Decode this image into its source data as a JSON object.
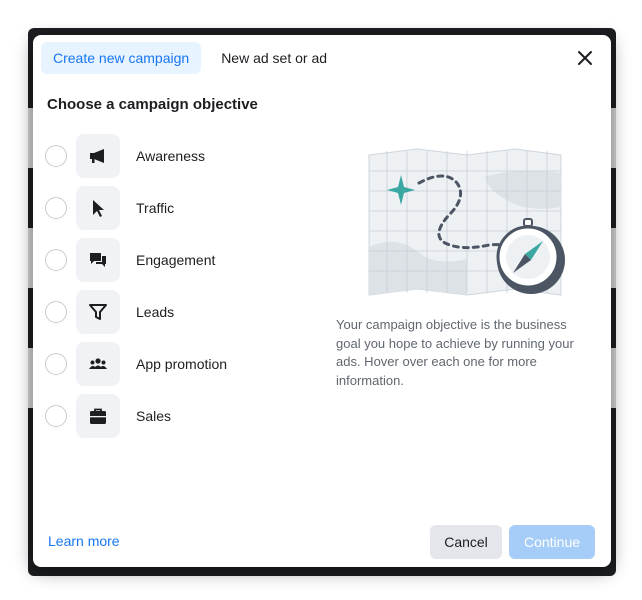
{
  "tabs": [
    {
      "label": "Create new campaign",
      "active": true
    },
    {
      "label": "New ad set or ad",
      "active": false
    }
  ],
  "heading": "Choose a campaign objective",
  "objectives": [
    {
      "label": "Awareness",
      "icon": "megaphone-icon"
    },
    {
      "label": "Traffic",
      "icon": "cursor-icon"
    },
    {
      "label": "Engagement",
      "icon": "chat-bubbles-icon"
    },
    {
      "label": "Leads",
      "icon": "funnel-icon"
    },
    {
      "label": "App promotion",
      "icon": "people-icon"
    },
    {
      "label": "Sales",
      "icon": "shopping-bag-icon"
    }
  ],
  "description": "Your campaign objective is the business goal you hope to achieve by running your ads. Hover over each one for more information.",
  "footer": {
    "learn_more": "Learn more",
    "cancel": "Cancel",
    "continue": "Continue"
  },
  "colors": {
    "accent": "#1877f2",
    "active_tab_bg": "#e7f3ff",
    "continue_disabled": "#a6cdf7",
    "illustration_teal": "#3aa7a3"
  }
}
